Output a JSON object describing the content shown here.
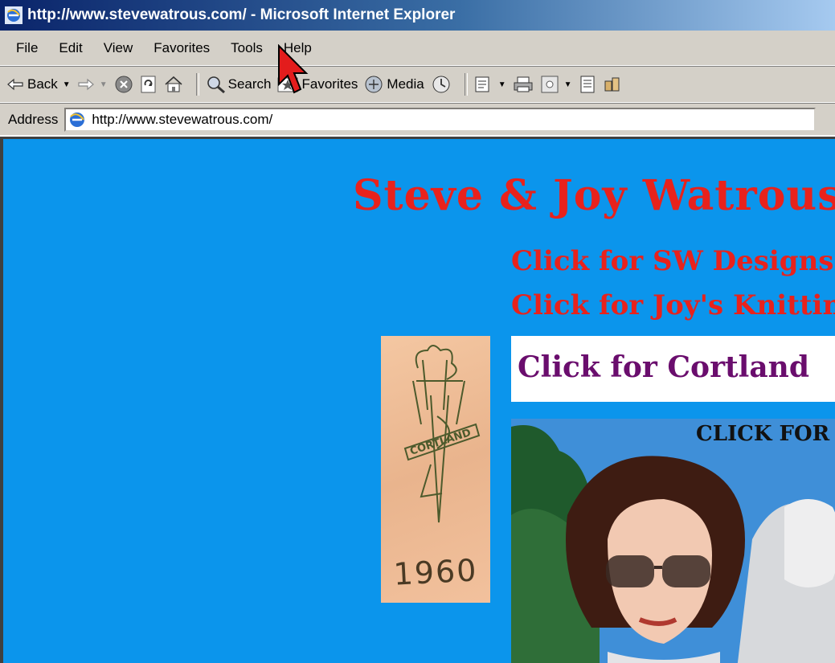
{
  "window": {
    "title": "http://www.stevewatrous.com/ - Microsoft Internet Explorer"
  },
  "menu": {
    "items": [
      "File",
      "Edit",
      "View",
      "Favorites",
      "Tools",
      "Help"
    ]
  },
  "toolbar": {
    "back": "Back",
    "search": "Search",
    "favorites": "Favorites",
    "media": "Media"
  },
  "address": {
    "label": "Address",
    "url": "http://www.stevewatrous.com/"
  },
  "page": {
    "title": "Steve & Joy Watrous",
    "link_sw": "Click for SW Designs",
    "link_joy": "Click for Joy's Knitting",
    "link_cortland": "Click for Cortland",
    "emblem_label": "CORTLAND",
    "emblem_year": "1960",
    "photo_caption": "CLICK FOR"
  },
  "colors": {
    "page_background": "#0b95ec",
    "title_red": "#e8221c",
    "cortland_purple": "#6a0d6d",
    "titlebar_blue": "#0a246a"
  }
}
